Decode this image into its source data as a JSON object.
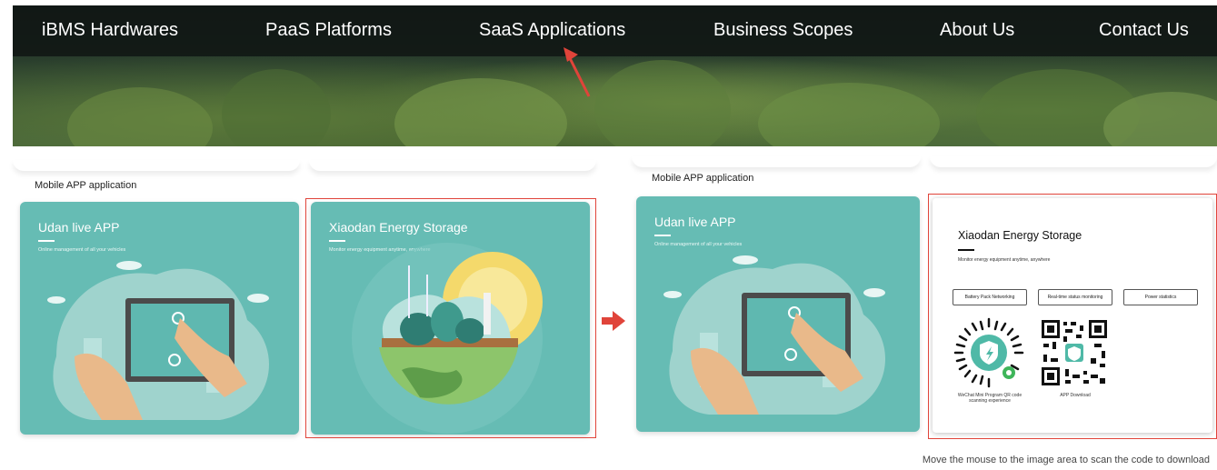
{
  "nav": {
    "items": [
      "iBMS Hardwares",
      "PaaS Platforms",
      "SaaS Applications",
      "Business Scopes",
      "About Us",
      "Contact Us"
    ]
  },
  "left_panel": {
    "section_label": "Mobile APP application",
    "card1": {
      "title": "Udan live APP",
      "subtitle": "Online management of all your vehicles"
    },
    "card2": {
      "title": "Xiaodan Energy Storage",
      "subtitle": "Monitor energy equipment anytime, anywhere"
    }
  },
  "right_panel": {
    "section_label": "Mobile APP application",
    "card1": {
      "title": "Udan live APP",
      "subtitle": "Online management of all your vehicles"
    },
    "card2": {
      "title": "Xiaodan Energy Storage",
      "subtitle": "Monitor energy equipment anytime, anywhere",
      "features": [
        "Battery Pack Networking",
        "Real-time status monitoring",
        "Power statistics"
      ],
      "qr1_caption": "WeChat Mini Program QR code scanning experience",
      "qr2_caption": "APP Download"
    }
  },
  "hint": "Move the mouse to the image area to scan the code to download",
  "colors": {
    "accent_red": "#e0443a",
    "card_teal": "#66bcb4",
    "nav_bg": "#0f1412"
  }
}
